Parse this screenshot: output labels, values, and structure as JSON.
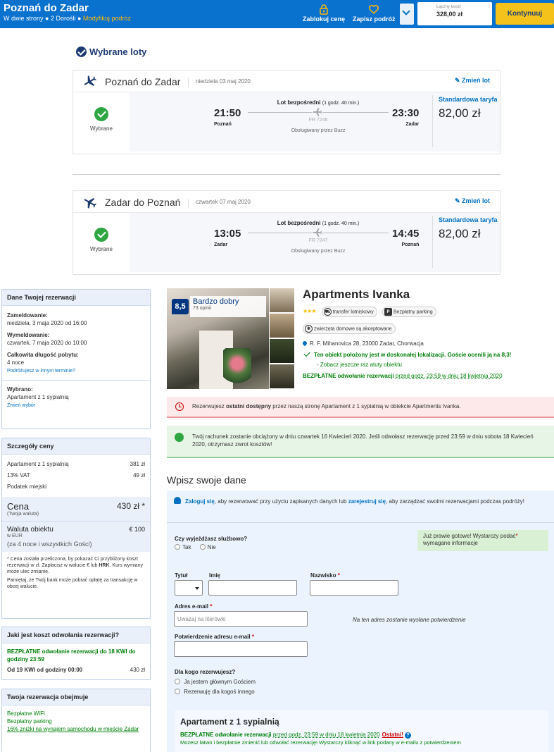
{
  "header": {
    "route": "Poznań do Zadar",
    "trip_type": "W dwie strony",
    "travelers": "2 Dorośli",
    "modify": "Modyfikuj podróż",
    "lock_price": "Zablokuj cenę",
    "save_trip": "Zapisz podróż",
    "total_label": "Łączny koszt",
    "total_value": "328,00 zł",
    "continue": "Kontynuuj"
  },
  "flights": {
    "section_title": "Wybrane loty",
    "items": [
      {
        "route": "Poznań do Zadar",
        "date": "niedziela 03 maj 2020",
        "change": "Zmień lot",
        "selected": "Wybrane",
        "dep_time": "21:50",
        "dep_city": "Poznań",
        "arr_time": "23:30",
        "arr_city": "Zadar",
        "direct": "Lot bezpośredni",
        "duration": "(1 godz. 40 min.)",
        "flight_no": "FR 7246",
        "operator": "Obsługiwany przez Buzz",
        "fare": "Standardowa taryfa",
        "price": "82,00 zł"
      },
      {
        "route": "Zadar do Poznań",
        "date": "czwartek 07 maj 2020",
        "change": "Zmień lot",
        "selected": "Wybrane",
        "dep_time": "13:05",
        "dep_city": "Zadar",
        "arr_time": "14:45",
        "arr_city": "Poznań",
        "direct": "Lot bezpośredni",
        "duration": "(1 godz. 40 min.)",
        "flight_no": "FR 7247",
        "operator": "Obsługiwany przez Buzz",
        "fare": "Standardowa taryfa",
        "price": "82,00 zł"
      }
    ]
  },
  "booking": {
    "title": "Dane Twojej rezerwacji",
    "checkin_label": "Zameldowanie:",
    "checkin_value": "niedziela, 3 maja 2020 od 16:00",
    "checkout_label": "Wymeldowanie:",
    "checkout_value": "czwartek, 7 maja 2020 do 10:00",
    "stay_label": "Całkowita długość pobytu:",
    "stay_value": "4 noce",
    "other_dates": "Podróżujesz w innym terminie?",
    "chosen_label": "Wybrano:",
    "chosen_value": "Apartament z 1 sypialnią",
    "change_choice": "Zmień wybór"
  },
  "price": {
    "title": "Szczegóły ceny",
    "rows": [
      {
        "label": "Apartament z 1 sypialnią",
        "value": "381 zł"
      },
      {
        "label": "13% VAT",
        "value": "49 zł"
      },
      {
        "label": "Podatek miejski",
        "value": ""
      }
    ],
    "total_label": "Cena",
    "total_sub": "(Twoja waluta)",
    "total_value": "430 zł *",
    "prop_label": "Waluta obiektu",
    "prop_sub": "w EUR",
    "prop_value": "€ 100",
    "for_whom": "(za 4 noce i wszystkich Gości)",
    "note1_a": "* Cena została przeliczona, by pokazać Ci przybliżony koszt rezerwacji w zł. Zapłacisz w walucie € lub",
    "note1_b": "HRK",
    "note1_c": ". Kurs wymiany może ulec zmianie.",
    "note2": "Pamiętaj, że Twój bank może pobrać opłatę za transakcję w obcej walucie."
  },
  "cancel": {
    "title": "Jaki jest koszt odwołania rezerwacji?",
    "free": "BEZPŁATNE odwołanie rezerwacji do 18 KWI do godziny 23:59",
    "from_label": "Od 19 KWI od godziny 00:00",
    "from_value": "430 zł"
  },
  "includes": {
    "title": "Twoja rezerwacja obejmuje",
    "items": [
      "Bezpłatne WiFi",
      "Bezpłatny parking",
      "16% zniżki na wynajem samochodu w mieście Zadar"
    ]
  },
  "hotel": {
    "score": "8,5",
    "score_word": "Bardzo dobry",
    "reviews": "73 opinii",
    "name": "Apartments Ivanka",
    "stars": "★★★",
    "tag_transfer": "transfer lotniskowy",
    "tag_parking": "Bezpłatny parking",
    "tag_pets": "zwierzęta domowe są akceptowane",
    "address": "R. F. Mihanovica 28, 23000 Zadar, Chorwacja",
    "location": "Ten obiekt położony jest w doskonałej lokalizacji. Goście ocenili ją na 8,3!",
    "more": "Zobacz jeszcze raz atuty obiektu",
    "free_cancel": "BEZPŁATNE odwołanie rezerwacji",
    "free_cancel_when": "przed godz. 23:59 w dniu 18 kwietnia 2020"
  },
  "alerts": {
    "red_a": "Rezerwujesz",
    "red_b": "ostatni dostępny",
    "red_c": "przez naszą stronę Apartament z 1 sypialnią w obiekcie Apartments Ivanka.",
    "green": "Twój rachunek zostanie obciążony w dniu czwartek 16 Kwiecień 2020. Jeśli odwołasz rezerwację przed 23:59 w dniu sobota 18 Kwiecień 2020, otrzymasz zwrot kosztów!"
  },
  "form": {
    "title": "Wpisz swoje dane",
    "login": "Zaloguj się",
    "login_mid": ", aby rezerwować przy użyciu zapisanych danych lub",
    "register": "zarejestruj się",
    "login_end": ", aby zarządzać swoimi rezerwacjami podczas podróży!",
    "business_q": "Czy wyjeżdżasz służbowo?",
    "yes": "Tak",
    "no": "Nie",
    "tip": "Już prawie gotowe! Wystarczy podać",
    "tip2": "wymagane informacje",
    "title_label": "Tytuł",
    "first_label": "Imię",
    "last_label": "Nazwisko",
    "email_label": "Adres e-mail",
    "email_placeholder": "Uważaj na literówki",
    "email_hint": "Na ten adres zostanie wysłane potwierdzenie",
    "confirm_label": "Potwierdzenie adresu e-mail",
    "for_whom_q": "Dla kogo rezerwujesz?",
    "opt_main": "Ja jestem głównym Gościem",
    "opt_other": "Rezerwuję dla kogoś innego",
    "asterisk": "*"
  },
  "room": {
    "title": "Apartament z 1 sypialnią",
    "free": "BEZPŁATNE odwołanie rezerwacji",
    "when": "przed godz. 23:59 w dniu 18 kwietnia 2020",
    "last": "Ostatni!",
    "help": "?",
    "desc": "Możesz łatwo i bezpłatnie zmienić lub odwołać rezerwację! Wystarczy kliknąć w link podany w e-mailu z potwierdzeniem"
  },
  "colors": {
    "brand_blue": "#0971ce",
    "navy": "#1e3a73",
    "accent_yellow": "#f5c21b",
    "success_green": "#008009",
    "alert_red": "#cc0000"
  }
}
